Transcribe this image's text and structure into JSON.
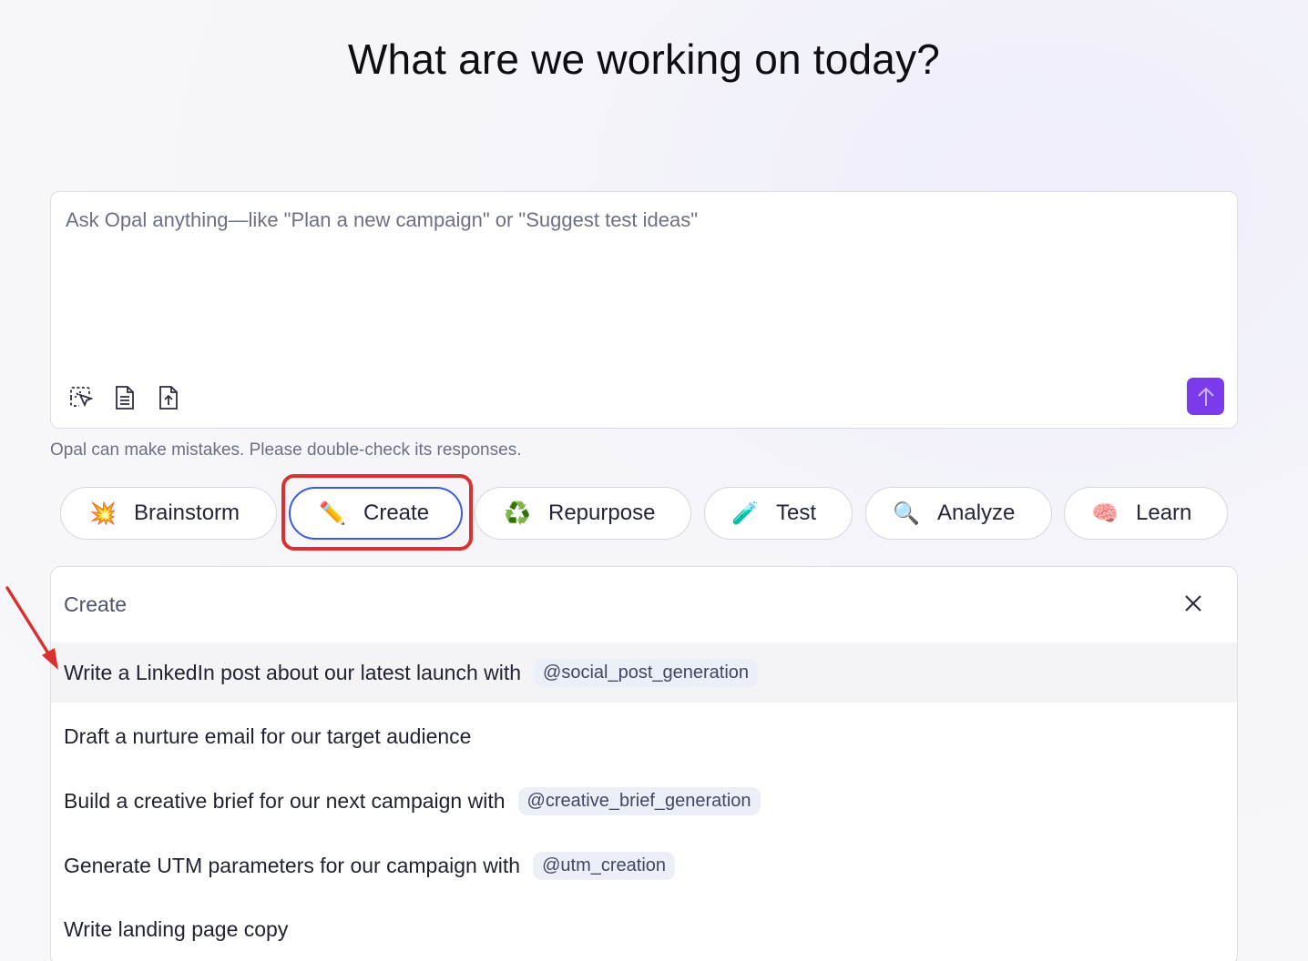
{
  "page": {
    "title": "What are we working on today?"
  },
  "composer": {
    "placeholder": "Ask Opal anything—like \"Plan a new campaign\" or \"Suggest test ideas\"",
    "tools": [
      "select-element-icon",
      "document-icon",
      "upload-file-icon"
    ],
    "send_icon": "arrow-up-icon",
    "send_color": "#7c3aed"
  },
  "disclaimer": "Opal can make mistakes. Please double-check its responses.",
  "chips": [
    {
      "label": "Brainstorm",
      "emoji": "💥"
    },
    {
      "label": "Create",
      "emoji": "✏️",
      "selected": true
    },
    {
      "label": "Repurpose",
      "emoji": "♻️"
    },
    {
      "label": "Test",
      "emoji": "🧪"
    },
    {
      "label": "Analyze",
      "emoji": "🔍"
    },
    {
      "label": "Learn",
      "emoji": "🧠"
    }
  ],
  "panel": {
    "header": "Create",
    "close_icon": "close-icon",
    "items": [
      {
        "text": "Write a LinkedIn post about our latest launch with",
        "tag": "@social_post_generation"
      },
      {
        "text": "Draft a nurture email for our target audience",
        "tag": ""
      },
      {
        "text": "Build a creative brief for our next campaign with",
        "tag": "@creative_brief_generation"
      },
      {
        "text": "Generate UTM parameters for our campaign with",
        "tag": "@utm_creation"
      },
      {
        "text": "Write landing page copy",
        "tag": ""
      }
    ]
  },
  "colors": {
    "highlight": "#d93030",
    "selected_border": "#3b5bdb"
  }
}
